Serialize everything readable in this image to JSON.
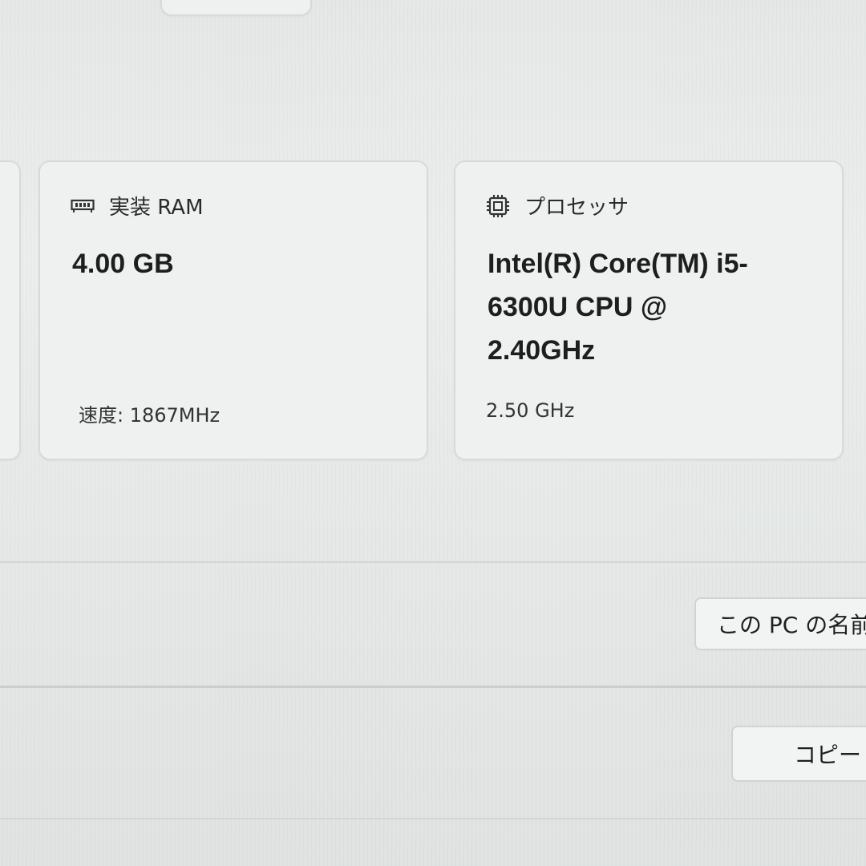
{
  "ram_card": {
    "icon": "memory-icon",
    "title": "実装 RAM",
    "value": "4.00 GB",
    "speed": "速度: 1867MHz"
  },
  "cpu_card": {
    "icon": "processor-chip-icon",
    "title": "プロセッサ",
    "value": "Intel(R) Core(TM) i5-6300U CPU @ 2.40GHz",
    "clock": "2.50 GHz"
  },
  "buttons": {
    "rename_label": "この PC の名前",
    "copy_label": "コピー"
  }
}
